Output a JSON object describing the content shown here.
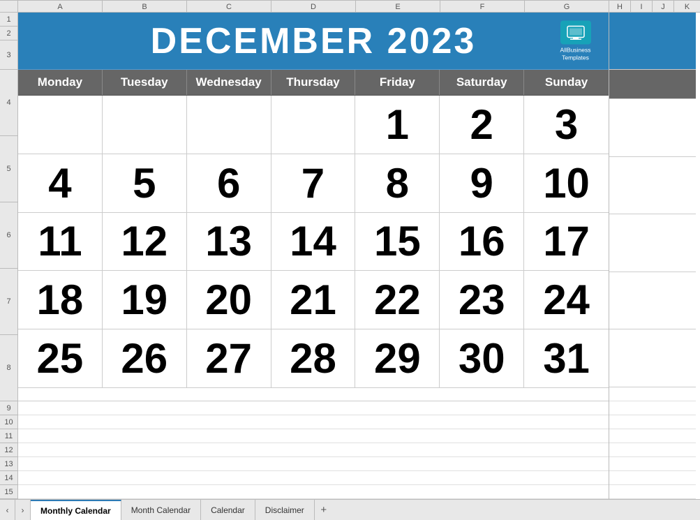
{
  "header": {
    "month": "DECEMBER",
    "year": "2023",
    "title": "DECEMBER 2023"
  },
  "brand": {
    "name": "AllBusiness\nTemplates"
  },
  "columns": {
    "spreadsheet": [
      "A",
      "B",
      "C",
      "D",
      "E",
      "F",
      "G"
    ],
    "right": [
      "H",
      "I",
      "J",
      "K"
    ]
  },
  "row_numbers": [
    "1",
    "2",
    "3",
    "4",
    "5",
    "6",
    "7",
    "8",
    "9",
    "10",
    "11",
    "12",
    "13",
    "14",
    "15"
  ],
  "day_headers": [
    "Monday",
    "Tuesday",
    "Wednesday",
    "Thursday",
    "Friday",
    "Saturday",
    "Sunday"
  ],
  "weeks": [
    [
      "",
      "",
      "",
      "",
      "1",
      "2",
      "3"
    ],
    [
      "4",
      "5",
      "6",
      "7",
      "8",
      "9",
      "10"
    ],
    [
      "11",
      "12",
      "13",
      "14",
      "15",
      "16",
      "17"
    ],
    [
      "18",
      "19",
      "20",
      "21",
      "22",
      "23",
      "24"
    ],
    [
      "25",
      "26",
      "27",
      "28",
      "29",
      "30",
      "31"
    ]
  ],
  "tabs": [
    {
      "label": "Monthly Calendar",
      "active": true
    },
    {
      "label": "Month Calendar",
      "active": false
    },
    {
      "label": "Calendar",
      "active": false
    },
    {
      "label": "Disclaimer",
      "active": false
    }
  ],
  "colors": {
    "header_bg": "#2980b9",
    "day_header_bg": "#666666",
    "accent": "#2c7bb6"
  }
}
